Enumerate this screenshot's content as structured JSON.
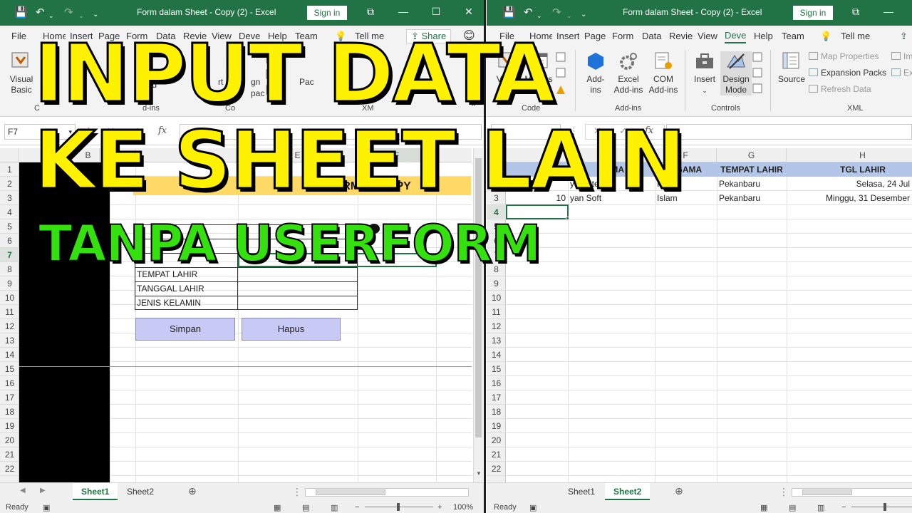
{
  "left": {
    "title": "Form dalam Sheet - Copy (2)  -  Excel",
    "sign_in": "Sign in",
    "tabs": [
      "File",
      "Home",
      "Insert",
      "Page",
      "Form",
      "Data",
      "Revie",
      "View",
      "Deve",
      "Help",
      "Team"
    ],
    "tell_me": "Tell me",
    "share": "Share",
    "ribbon": {
      "visual": "Visual",
      "basic": "Basic",
      "ad": "Ad",
      "ins": "ins",
      "ins_ad": "ns  Ad",
      "fragments": [
        "rt",
        "gn",
        "pac",
        "Pac",
        "P"
      ],
      "groups": [
        "C",
        "d-ins",
        "Co",
        "XM"
      ]
    },
    "name_box": "F7",
    "columns": [
      "B",
      "C",
      "E",
      "F"
    ],
    "rows": [
      "1",
      "2",
      "3",
      "4",
      "5",
      "6",
      "7",
      "8",
      "9",
      "10",
      "11",
      "12",
      "13",
      "14",
      "15",
      "16",
      "17",
      "18",
      "19",
      "20",
      "21",
      "22"
    ],
    "banner_fragment": "FORM DATA  PY",
    "form_labels": [
      "TEMPAT LAHIR",
      "TANGGAL LAHIR",
      "JENIS KELAMIN"
    ],
    "btn_simpan": "Simpan",
    "btn_hapus": "Hapus",
    "sheets": [
      "Sheet1",
      "Sheet2"
    ],
    "status": "Ready",
    "zoom": "100%"
  },
  "right": {
    "title": "Form dalam Sheet - Copy (2)  -  Excel",
    "sign_in": "Sign in",
    "tabs": [
      "File",
      "Home",
      "Insert",
      "Page",
      "Form",
      "Data",
      "Revie",
      "View",
      "Deve",
      "Help",
      "Team"
    ],
    "tell_me": "Tell me",
    "ribbon": {
      "visual": "Visual",
      "basic": "Basic",
      "macros": "Macros",
      "add": "Add-",
      "ins": "ins",
      "excel": "Excel",
      "excel_addins": "Add-ins",
      "com": "COM",
      "com_addins": "Add-ins",
      "insert": "Insert",
      "design": "Design",
      "mode": "Mode",
      "source": "Source",
      "map_properties": "Map Properties",
      "expansion_packs": "Expansion Packs",
      "refresh_data": "Refresh Data",
      "im": "Im",
      "ex": "Ex",
      "groups": [
        "Code",
        "Add-ins",
        "Controls",
        "XML"
      ]
    },
    "name_box": "D4",
    "columns": [
      "E",
      "F",
      "G",
      "H"
    ],
    "rows": [
      "1",
      "2",
      "3",
      "4",
      "5",
      "6",
      "7",
      "8",
      "9",
      "10",
      "11",
      "12",
      "13",
      "14",
      "15",
      "16",
      "17",
      "18",
      "19",
      "20",
      "21",
      "22"
    ],
    "headers": [
      "NAMA",
      "AGAMA",
      "TEMPAT LAHIR",
      "TGL LAHIR"
    ],
    "data_rows": [
      [
        "yan Stevig",
        "Islam",
        "Pekanbaru",
        "Selasa, 24 Jul"
      ],
      [
        "yan Soft",
        "Islam",
        "Pekanbaru",
        "Minggu, 31 Desember"
      ]
    ],
    "row2_id_fragment": "10",
    "sheets": [
      "Sheet1",
      "Sheet2"
    ],
    "status": "Ready"
  },
  "overlay": {
    "line1": "INPUT DATA",
    "line2": "KE SHEET LAIN",
    "line3": "TANPA USERFORM"
  },
  "colors": {
    "excel_green": "#217346",
    "header_fill": "#b4c6e7",
    "button_fill": "#c9c9f5",
    "overlay_yellow": "#fff200",
    "overlay_green": "#35e00f"
  }
}
